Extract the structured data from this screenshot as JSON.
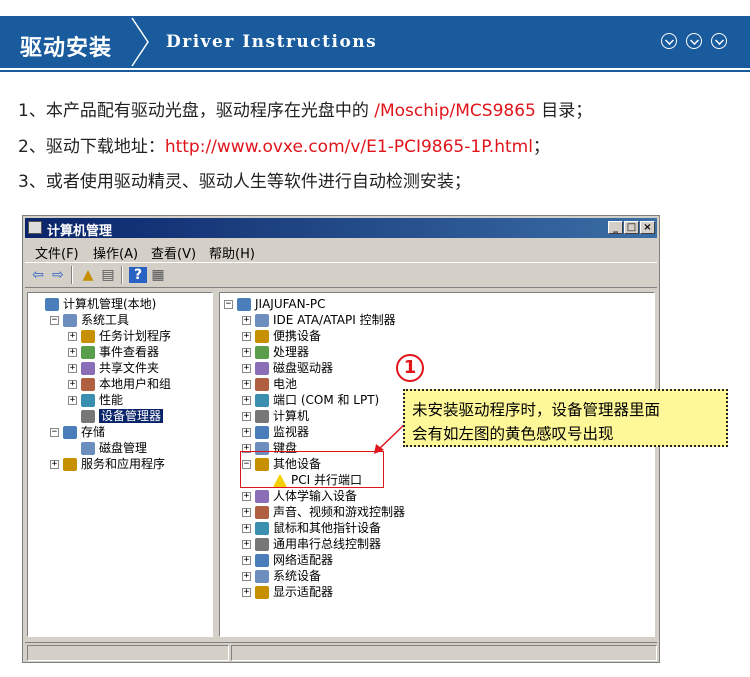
{
  "header": {
    "title_cn": "驱动安装",
    "title_en": "Driver Instructions",
    "icons": [
      "chevron-down-icon",
      "chevron-down-icon",
      "chevron-down-icon"
    ]
  },
  "instructions": [
    {
      "prefix": "1、本产品配有驱动光盘，驱动程序在光盘中的 ",
      "highlight": "/Moschip/MCS9865",
      "suffix": " 目录；"
    },
    {
      "prefix": "2、驱动下载地址：",
      "highlight": "http://www.ovxe.com/v/E1-PCI9865-1P.html",
      "suffix": "；"
    },
    {
      "prefix": "3、或者使用驱动精灵、驱动人生等软件进行自动检测安装；",
      "highlight": "",
      "suffix": ""
    }
  ],
  "window": {
    "title": "计算机管理",
    "buttons": {
      "minimize": "_",
      "maximize": "□",
      "close": "×"
    },
    "menu": [
      "文件(F)",
      "操作(A)",
      "查看(V)",
      "帮助(H)"
    ],
    "left_tree": [
      {
        "label": "计算机管理(本地)",
        "exp": "",
        "indent": 0
      },
      {
        "label": "系统工具",
        "exp": "⊟",
        "indent": 1
      },
      {
        "label": "任务计划程序",
        "exp": "⊞",
        "indent": 2
      },
      {
        "label": "事件查看器",
        "exp": "⊞",
        "indent": 2
      },
      {
        "label": "共享文件夹",
        "exp": "⊞",
        "indent": 2
      },
      {
        "label": "本地用户和组",
        "exp": "⊞",
        "indent": 2
      },
      {
        "label": "性能",
        "exp": "⊞",
        "indent": 2
      },
      {
        "label": "设备管理器",
        "exp": "",
        "indent": 2,
        "selected": true
      },
      {
        "label": "存储",
        "exp": "⊟",
        "indent": 1
      },
      {
        "label": "磁盘管理",
        "exp": "",
        "indent": 2
      },
      {
        "label": "服务和应用程序",
        "exp": "⊞",
        "indent": 1
      }
    ],
    "right_tree": [
      {
        "label": "JIAJUFAN-PC",
        "exp": "⊟",
        "indent": 0
      },
      {
        "label": "IDE ATA/ATAPI 控制器",
        "exp": "⊞",
        "indent": 1
      },
      {
        "label": "便携设备",
        "exp": "⊞",
        "indent": 1
      },
      {
        "label": "处理器",
        "exp": "⊞",
        "indent": 1
      },
      {
        "label": "磁盘驱动器",
        "exp": "⊞",
        "indent": 1
      },
      {
        "label": "电池",
        "exp": "⊞",
        "indent": 1
      },
      {
        "label": "端口 (COM 和 LPT)",
        "exp": "⊞",
        "indent": 1
      },
      {
        "label": "计算机",
        "exp": "⊞",
        "indent": 1
      },
      {
        "label": "监视器",
        "exp": "⊞",
        "indent": 1
      },
      {
        "label": "键盘",
        "exp": "⊞",
        "indent": 1
      },
      {
        "label": "其他设备",
        "exp": "⊟",
        "indent": 1
      },
      {
        "label": "PCI 并行端口",
        "exp": "",
        "indent": 2,
        "warning": true
      },
      {
        "label": "人体学输入设备",
        "exp": "⊞",
        "indent": 1
      },
      {
        "label": "声音、视频和游戏控制器",
        "exp": "⊞",
        "indent": 1
      },
      {
        "label": "鼠标和其他指针设备",
        "exp": "⊞",
        "indent": 1
      },
      {
        "label": "通用串行总线控制器",
        "exp": "⊞",
        "indent": 1
      },
      {
        "label": "网络适配器",
        "exp": "⊞",
        "indent": 1
      },
      {
        "label": "系统设备",
        "exp": "⊞",
        "indent": 1
      },
      {
        "label": "显示适配器",
        "exp": "⊞",
        "indent": 1
      }
    ]
  },
  "annotation": {
    "number": "1",
    "text_line1": "未安装驱动程序时，设备管理器里面",
    "text_line2": "会有如左图的黄色感叹号出现"
  },
  "colors": {
    "header_blue": "#1a5b9e",
    "accent_red": "#e0141b",
    "callout_yellow": "#fff898"
  }
}
